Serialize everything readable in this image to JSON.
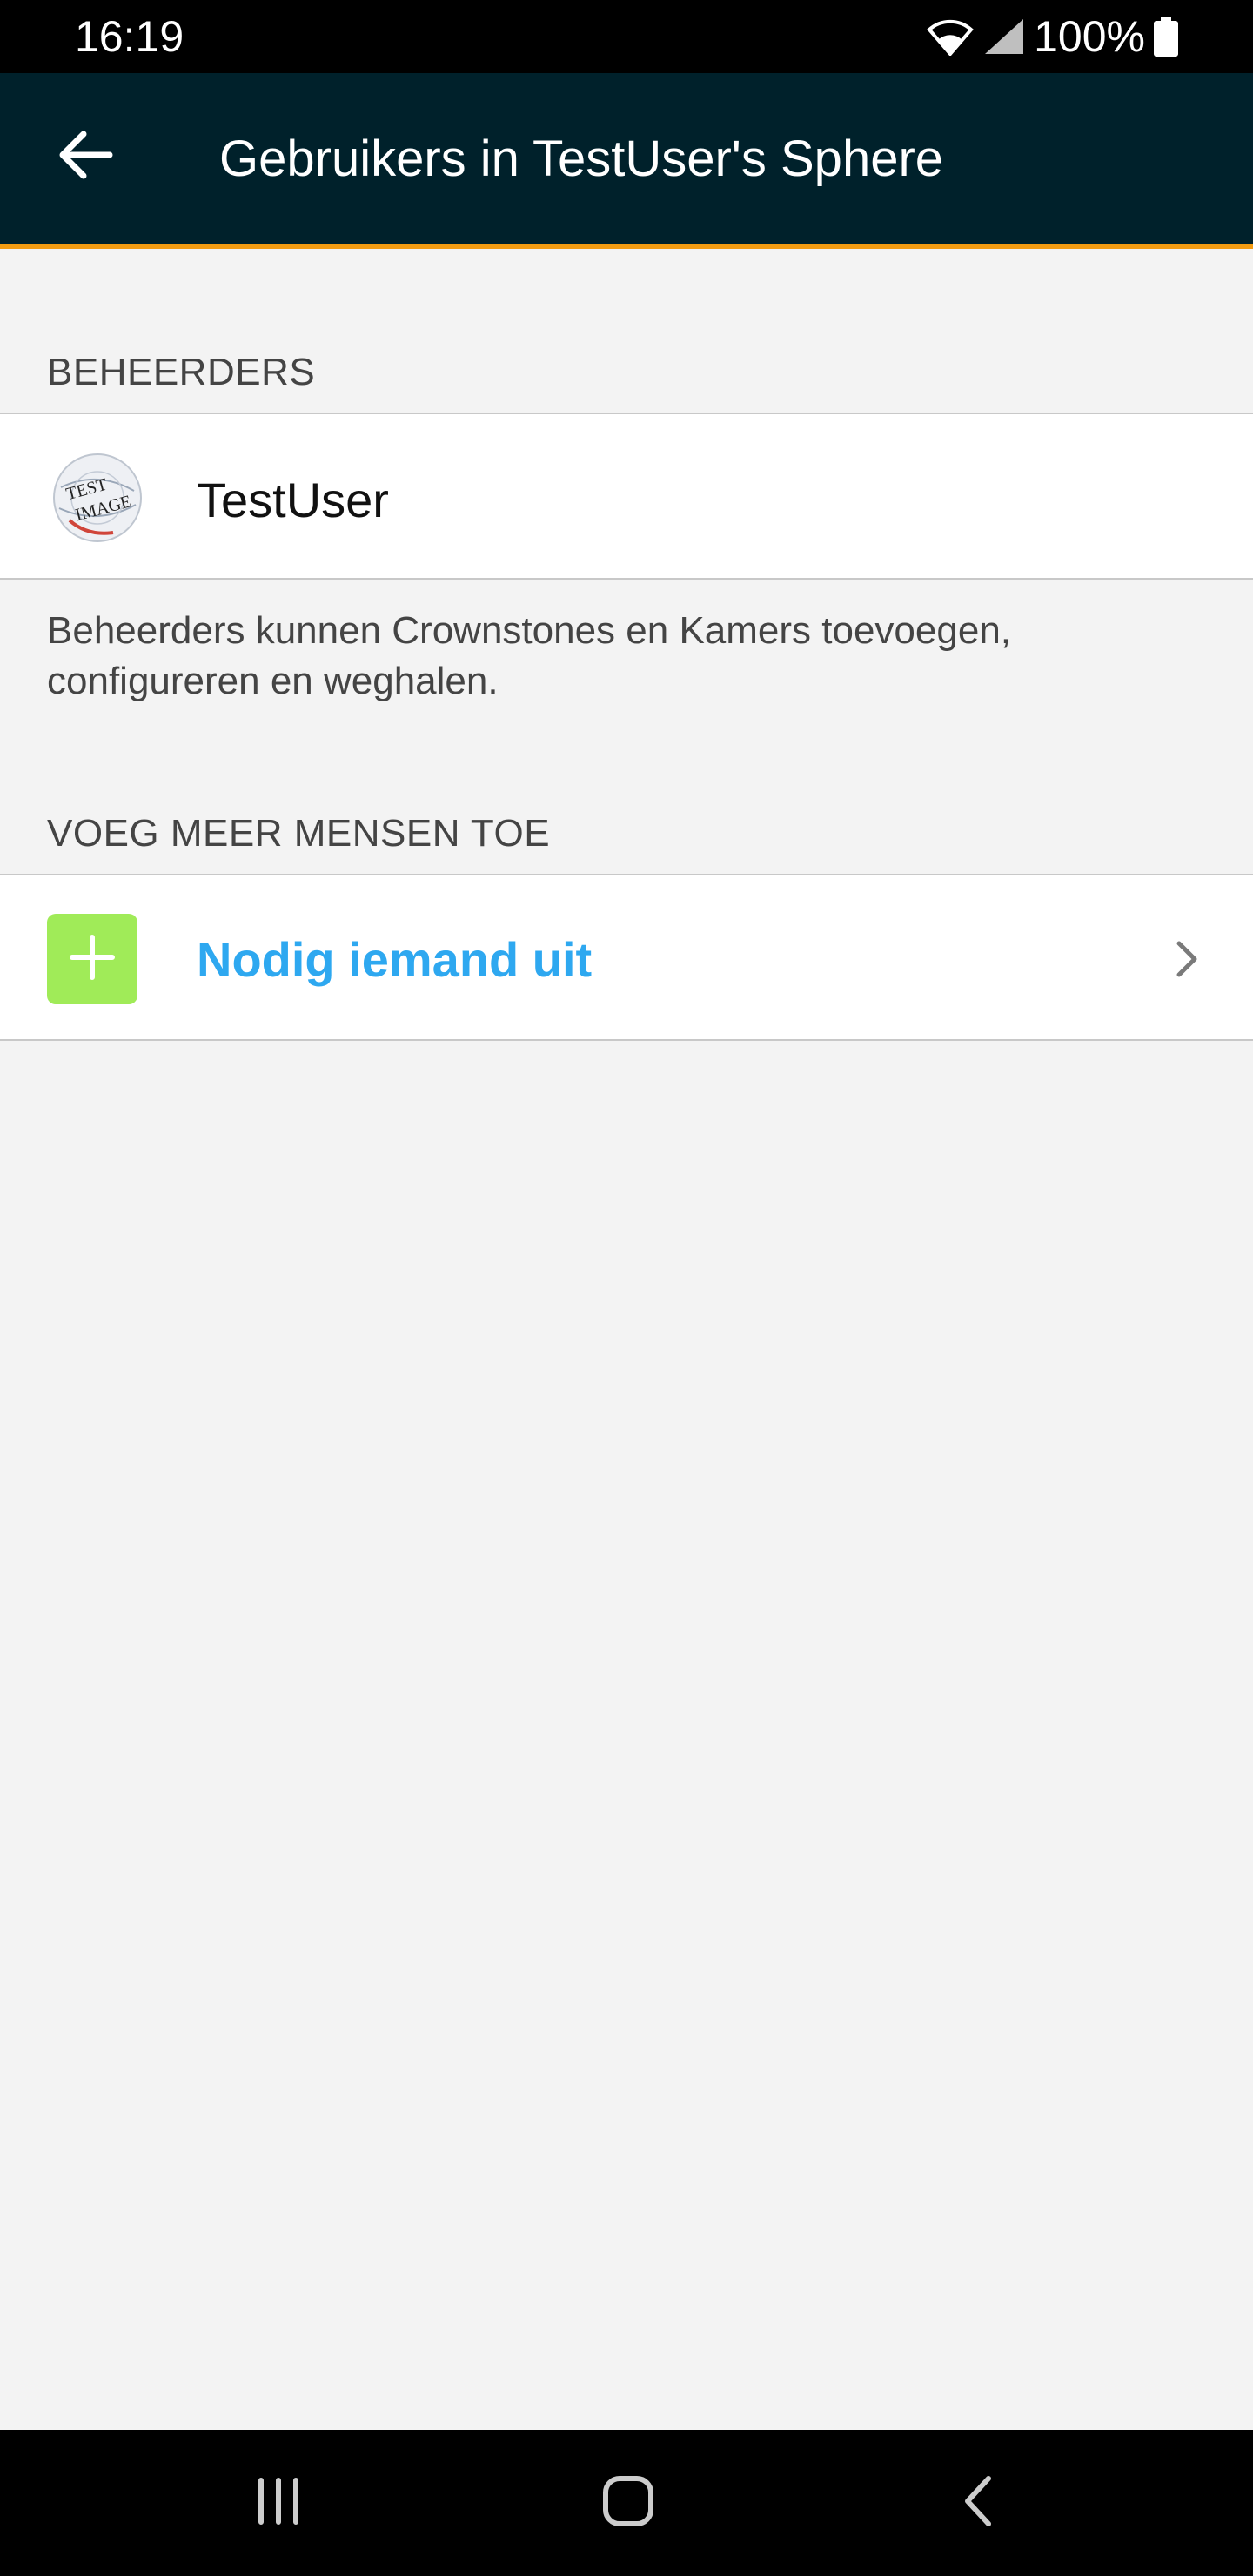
{
  "status_bar": {
    "time": "16:19",
    "battery": "100%",
    "icons": [
      "wifi-icon",
      "signal-icon",
      "battery-icon"
    ]
  },
  "header": {
    "title": "Gebruikers in TestUser's Sphere",
    "back_icon": "arrow-left-icon",
    "accent_color": "#f39c12",
    "background_color": "#00212b"
  },
  "admins_section": {
    "heading": "BEHEERDERS",
    "users": [
      {
        "name": "TestUser",
        "avatar_lines": [
          "TEST",
          "IMAGE"
        ]
      }
    ],
    "description": "Beheerders kunnen Crownstones en Kamers toevoegen, configureren en weghalen."
  },
  "add_section": {
    "heading": "VOEG MEER MENSEN TOE",
    "invite_label": "Nodig iemand uit",
    "invite_icon": "plus-icon",
    "invite_color": "#2ea8f0",
    "icon_bg_color": "#a0eb58"
  },
  "nav": {
    "icons": [
      "recent-apps-icon",
      "home-icon",
      "back-icon"
    ]
  }
}
